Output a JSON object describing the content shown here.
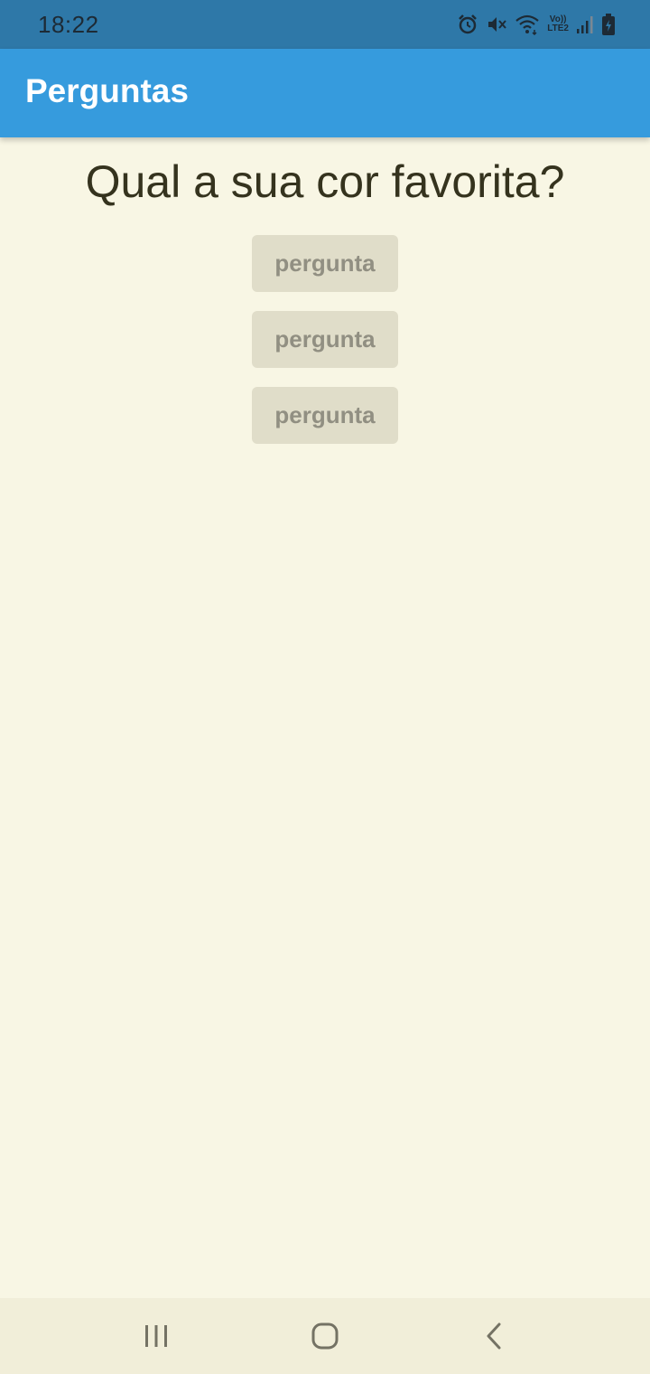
{
  "status_bar": {
    "time": "18:22",
    "icons": [
      "alarm-icon",
      "mute-icon",
      "wifi-icon",
      "volte-lte2-icon",
      "signal-icon",
      "battery-charging-icon"
    ],
    "volte_label": "Vo))",
    "lte_label": "LTE2"
  },
  "app_bar": {
    "title": "Perguntas",
    "color": "#369bdd"
  },
  "main": {
    "question": "Qual a sua cor favorita?",
    "answers": [
      {
        "label": "pergunta"
      },
      {
        "label": "pergunta"
      },
      {
        "label": "pergunta"
      }
    ],
    "background": "#f8f6e4"
  },
  "nav_bar": {
    "buttons": [
      "recent-apps-icon",
      "home-icon",
      "back-icon"
    ]
  }
}
